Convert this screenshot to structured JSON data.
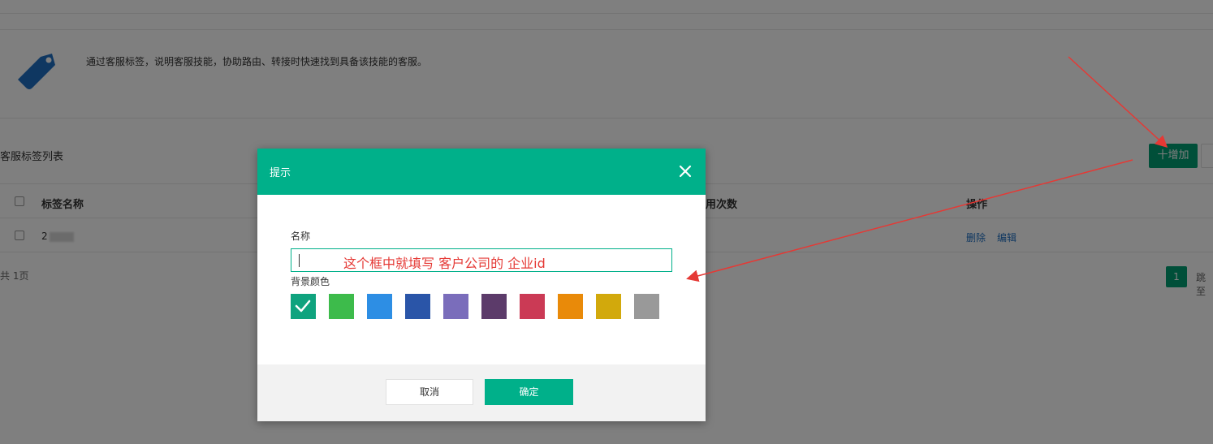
{
  "intro": {
    "description": "通过客服标签，说明客服技能，协助路由、转接时快速找到具备该技能的客服。"
  },
  "list": {
    "title": "客服标签列表",
    "add_button": "十增加",
    "columns": {
      "name": "标签名称",
      "usage": "用次数",
      "actions": "操作"
    },
    "rows": [
      {
        "name": "2"
      }
    ],
    "row_actions": {
      "delete": "删除",
      "edit": "编辑"
    }
  },
  "pagination": {
    "page_info": "共 1页",
    "current_page": "1",
    "goto": "跳至"
  },
  "dialog": {
    "title": "提示",
    "name_label": "名称",
    "annotation": "这个框中就填写  客户公司的 企业id",
    "color_label": "背景颜色",
    "colors": [
      "#0fa37e",
      "#3dbb4b",
      "#2d8ee4",
      "#2a55a8",
      "#7a6dbb",
      "#5c3b6a",
      "#cb3a55",
      "#e98a09",
      "#d2a90c",
      "#999999"
    ],
    "selected_color_index": 0,
    "cancel_label": "取消",
    "ok_label": "确定"
  }
}
